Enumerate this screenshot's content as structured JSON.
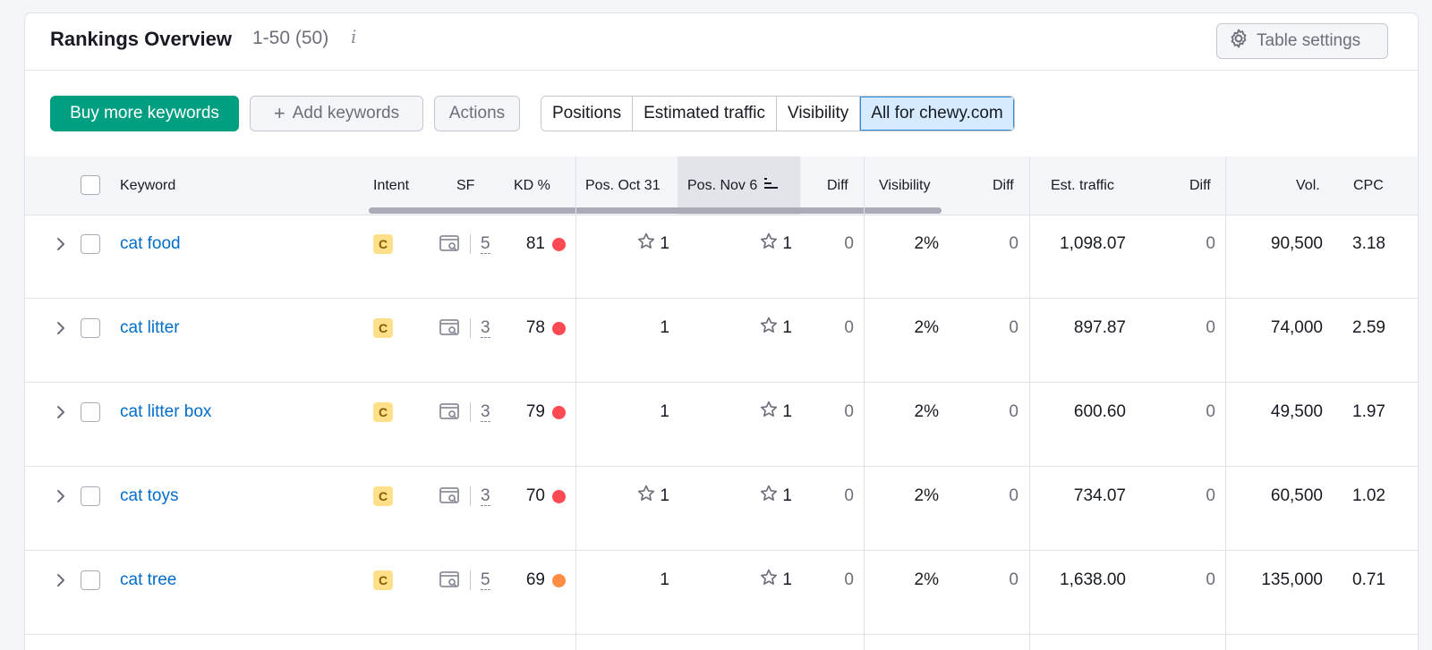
{
  "header": {
    "title": "Rankings Overview",
    "range": "1-50 (50)",
    "info_glyph": "i",
    "settings_label": "Table settings"
  },
  "toolbar": {
    "buy_label": "Buy more keywords",
    "add_label": "Add keywords",
    "add_icon": "+",
    "actions_label": "Actions",
    "segments": [
      "Positions",
      "Estimated traffic",
      "Visibility",
      "All for chewy.com"
    ],
    "active_segment": "All for chewy.com"
  },
  "columns": {
    "keyword": "Keyword",
    "intent": "Intent",
    "sf": "SF",
    "kd": "KD %",
    "pos_oct": "Pos. Oct 31",
    "pos_nov": "Pos. Nov 6",
    "diff1": "Diff",
    "visibility": "Visibility",
    "diff2": "Diff",
    "traffic": "Est. traffic",
    "diff3": "Diff",
    "vol": "Vol.",
    "cpc": "CPC"
  },
  "rows": [
    {
      "keyword": "cat food",
      "intent": "C",
      "sf": "5",
      "kd": "81",
      "kd_level": "red",
      "pos_oct": "1",
      "pos_oct_star": true,
      "pos_nov": "1",
      "diff1": "0",
      "visibility": "2%",
      "diff2": "0",
      "traffic": "1,098.07",
      "diff3": "0",
      "vol": "90,500",
      "cpc": "3.18"
    },
    {
      "keyword": "cat litter",
      "intent": "C",
      "sf": "3",
      "kd": "78",
      "kd_level": "red",
      "pos_oct": "1",
      "pos_oct_star": false,
      "pos_nov": "1",
      "diff1": "0",
      "visibility": "2%",
      "diff2": "0",
      "traffic": "897.87",
      "diff3": "0",
      "vol": "74,000",
      "cpc": "2.59"
    },
    {
      "keyword": "cat litter box",
      "intent": "C",
      "sf": "3",
      "kd": "79",
      "kd_level": "red",
      "pos_oct": "1",
      "pos_oct_star": false,
      "pos_nov": "1",
      "diff1": "0",
      "visibility": "2%",
      "diff2": "0",
      "traffic": "600.60",
      "diff3": "0",
      "vol": "49,500",
      "cpc": "1.97"
    },
    {
      "keyword": "cat toys",
      "intent": "C",
      "sf": "3",
      "kd": "70",
      "kd_level": "red",
      "pos_oct": "1",
      "pos_oct_star": true,
      "pos_nov": "1",
      "diff1": "0",
      "visibility": "2%",
      "diff2": "0",
      "traffic": "734.07",
      "diff3": "0",
      "vol": "60,500",
      "cpc": "1.02"
    },
    {
      "keyword": "cat tree",
      "intent": "C",
      "sf": "5",
      "kd": "69",
      "kd_level": "orange",
      "pos_oct": "1",
      "pos_oct_star": false,
      "pos_nov": "1",
      "diff1": "0",
      "visibility": "2%",
      "diff2": "0",
      "traffic": "1,638.00",
      "diff3": "0",
      "vol": "135,000",
      "cpc": "0.71"
    }
  ],
  "colors": {
    "primary": "#009f81",
    "link": "#006dca",
    "kd_red": "#ff4953",
    "kd_orange": "#ff8c43",
    "intent_bg": "#ffe08a"
  },
  "icons": {
    "settings": "gear-icon",
    "sort": "sort-icon",
    "expand": "chevron-right-icon",
    "sf": "serp-features-icon",
    "star": "star-icon"
  }
}
